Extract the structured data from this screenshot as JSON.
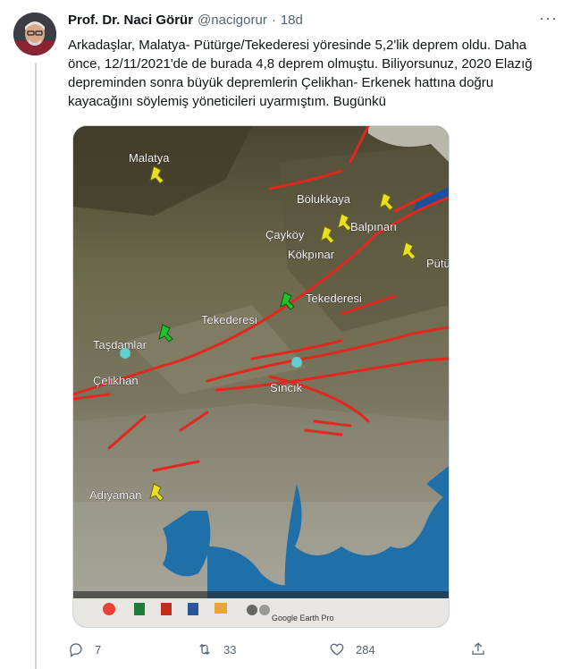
{
  "tweet": {
    "author_name": "Prof. Dr. Naci Görür",
    "author_handle": "@nacigorur",
    "separator": "·",
    "time": "18d",
    "more_label": "···",
    "text": "Arkadaşlar, Malatya- Pütürge/Tekederesi yöresinde 5,2'lik deprem oldu. Daha önce, 12/11/2021'de de burada 4,8 deprem olmuştu. Biliyorsunuz, 2020 Elazığ depreminden sonra büyük depremlerin Çelikhan- Erkenek hattına doğru kayacağını söylemiş yöneticileri uyarmıştım. Bugünkü"
  },
  "map_image": {
    "labels": {
      "malatya": "Malatya",
      "bolukkaya": "Bölukkaya",
      "balpinari": "Balpınarı",
      "caykoy": "Çayköy",
      "kokpinar": "Kökpınar",
      "putu": "Pütü",
      "tekederesi_1": "Tekederesi",
      "tekederesi_2": "Tekederesi",
      "tasdamlar": "Taşdamlar",
      "celikhan": "Çelikhan",
      "sincik": "Sıncık",
      "adiyaman": "Adıyaman"
    },
    "taskbar_text": "Google Earth Pro",
    "icons": [
      "chrome-icon",
      "excel-icon",
      "pdf-icon",
      "word-icon",
      "files-icon",
      "app-icon",
      "app-icon"
    ]
  },
  "actions": {
    "reply_count": "7",
    "retweet_count": "33",
    "like_count": "284"
  },
  "colors": {
    "text_primary": "#0f1419",
    "text_secondary": "#536471",
    "fault_red": "#e0281e",
    "pin_yellow": "#e8e020",
    "pin_green": "#22c02a",
    "pin_cyan": "#5fd0d0",
    "water_blue": "#1f6fa8"
  }
}
